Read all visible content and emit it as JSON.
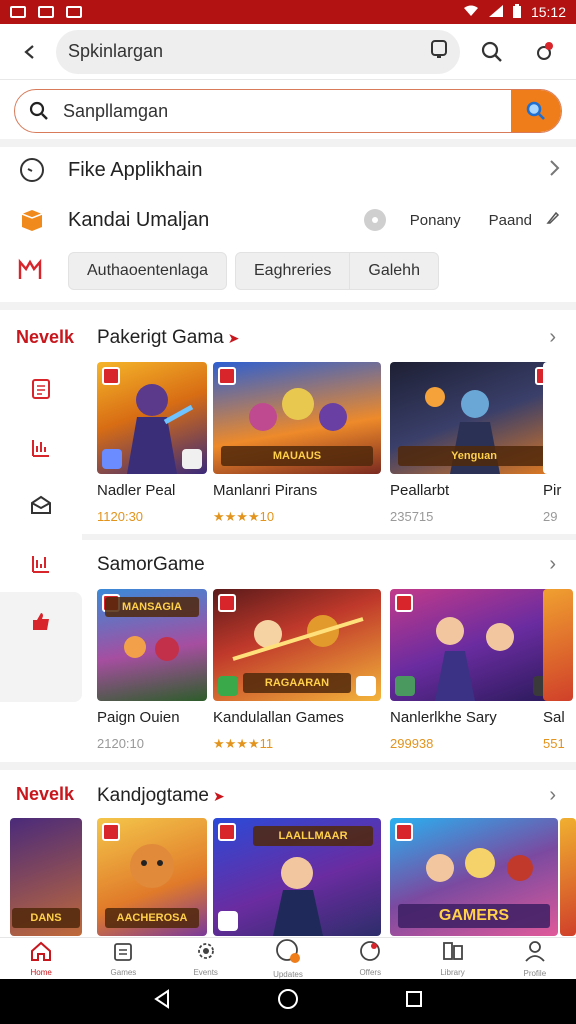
{
  "status_bar": {
    "time": "15:12",
    "accent": "#b31212"
  },
  "app_bar": {
    "title": "Spkinlargan",
    "icons": [
      "back-icon",
      "tablet-icon",
      "search-icon",
      "settings-icon"
    ]
  },
  "search": {
    "placeholder": "Sanpllamgan",
    "accent": "#ef7d1a"
  },
  "menu": {
    "row1": {
      "label": "Fike Applikhain",
      "icon": "clock-icon"
    },
    "row2": {
      "label": "Kandai Umaljan",
      "icon": "box-icon",
      "opt1": "Ponany",
      "opt2": "Paand"
    },
    "row3_chips": [
      "Authaoentenlaga",
      "Eaghreries",
      "Galehh"
    ]
  },
  "left_nav": {
    "heading1": "Nevelk",
    "heading2": "Nevelk"
  },
  "sections": [
    {
      "title": "Pakerigt Gama",
      "items": [
        {
          "name": "Nadler Peal",
          "meta": "1120:30",
          "meta_style": "gold"
        },
        {
          "name": "Manlanri Pirans",
          "meta": "★★★★10",
          "meta_style": "gold",
          "banner": "MAUAUS"
        },
        {
          "name": "Peallarbt",
          "meta": "235715",
          "meta_style": "grey",
          "banner": "Yenguan"
        },
        {
          "name": "Pir",
          "meta": "29",
          "meta_style": "grey"
        }
      ]
    },
    {
      "title": "SamorGame",
      "items": [
        {
          "name": "Paign Ouien",
          "meta": "2120:10",
          "meta_style": "grey",
          "banner": "MANSAGIA"
        },
        {
          "name": "Kandulallan Games",
          "meta": "★★★★11",
          "meta_style": "gold",
          "banner": "RAGAARAN"
        },
        {
          "name": "Nanlerlkhe Sary",
          "meta": "299938",
          "meta_style": "gold"
        },
        {
          "name": "Sal",
          "meta": "551",
          "meta_style": "gold"
        }
      ]
    },
    {
      "title": "Kandjogtame",
      "items": [
        {
          "name": "",
          "banner": "DANS"
        },
        {
          "name": "",
          "banner": "AACHEROSA"
        },
        {
          "name": "",
          "banner": "LAALLMAAR"
        },
        {
          "name": "",
          "banner": "GAMERS"
        }
      ]
    }
  ],
  "bottom_nav": [
    "Home",
    "Games",
    "Events",
    "Updates",
    "Offers",
    "Library",
    "Profile"
  ],
  "brand": {
    "red": "#c8161d",
    "orange": "#ef7d1a"
  }
}
